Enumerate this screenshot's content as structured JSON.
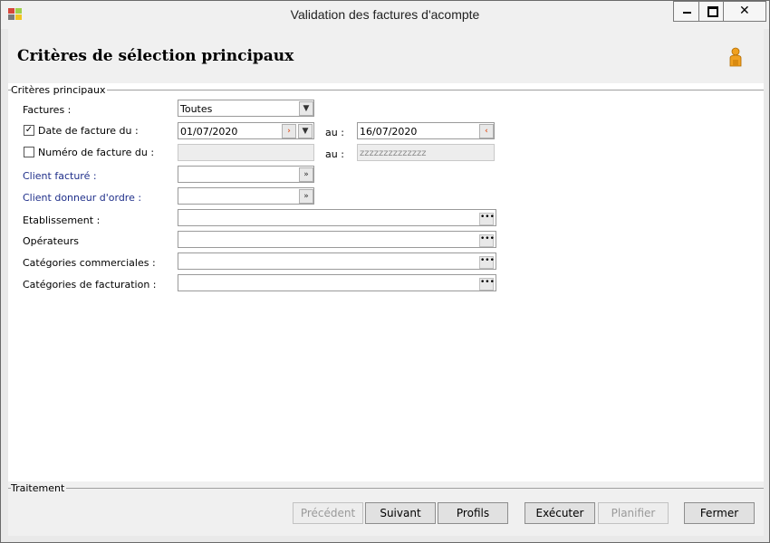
{
  "window": {
    "title": "Validation des factures d'acompte"
  },
  "header": {
    "title": "Critères de sélection principaux"
  },
  "sections": {
    "main": "Critères principaux",
    "treatment": "Traitement"
  },
  "form": {
    "factures_label": "Factures  :",
    "factures_value": "Toutes",
    "date_label": "Date de facture du :",
    "date_checked": true,
    "date_from": "01/07/2020",
    "date_to": "16/07/2020",
    "au_label": "au :",
    "numero_label": "Numéro de facture du :",
    "numero_checked": false,
    "numero_from": "",
    "numero_to": "zzzzzzzzzzzzzz",
    "client_facture_label": "Client facturé :",
    "client_donneur_label": "Client donneur d'ordre :",
    "etablissement_label": "Etablissement :",
    "operateurs_label": "Opérateurs",
    "categories_commerciales_label": "Catégories commerciales :",
    "categories_facturation_label": "Catégories de facturation :"
  },
  "buttons": {
    "precedent": "Précédent",
    "suivant": "Suivant",
    "profils": "Profils",
    "executer": "Exécuter",
    "planifier": "Planifier",
    "fermer": "Fermer"
  },
  "icons": {
    "minimize": "minimize-icon",
    "maximize": "maximize-icon",
    "close": "close-icon",
    "checkmark": "✓",
    "ellipsis": "•••"
  },
  "colors": {
    "label_blue": "#1f2f8a",
    "calendar_red": "#e05a2a",
    "person_orange": "#f0a020"
  }
}
